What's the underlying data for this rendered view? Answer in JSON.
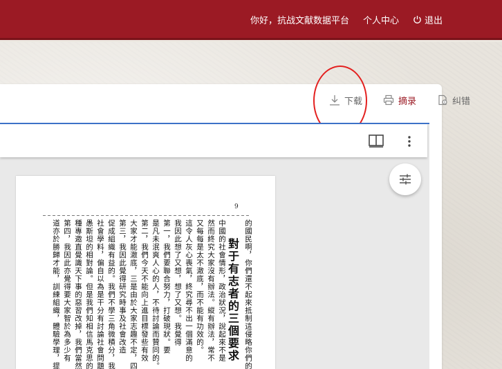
{
  "header": {
    "greeting": "你好，抗战文献数据平台",
    "personal_center": "个人中心",
    "logout": "退出"
  },
  "toolbar": {
    "download": "下载",
    "excerpt": "摘录",
    "correction": "纠错"
  },
  "document": {
    "page_number": "9",
    "columns": [
      "的國民啊，你們還不起來抵制這侵略你們的",
      "對于有志者的三個要求",
      "中國的社會情形，政治狀況，說起來不是",
      "然而終究大家沒有辦法。縱有辦法，常不",
      "又每每是太不澈底，而不能有功效的。",
      "這令人灰心喪氣，終究尋不出一個滿意的",
      "我因此想了又想，想了又想。我覺得",
      "第一，我們要聯合努力，打破現狀。要",
      "是凡未泯爽人心的人，不待討論而贊同的。",
      "第二，我們今天不能向上進目標發些有效",
      "大家才能澈底，三是由於大家志趣不定，四是",
      "第三，我因此覺得研究時事及社會改造",
      "促成組織有益的。我們不學三角微積分，我們",
      "社會學料，偏自以為是干分有討論社會問題的",
      "愚斯坦的相對論。但是我們知相信馬克思的唯",
      "種專邀直覺識天下事的惡習改掉，我們當然該",
      "第四，我因此亦覺得要大家智於為多少有",
      "道亦於勝歸才能，訓練組織，體驗學理，提高"
    ]
  },
  "icons": {
    "download": "download-icon",
    "excerpt": "printer-icon",
    "correction": "document-edit-icon",
    "logout": "power-icon",
    "viewer_mode": "book-icon",
    "more": "more-vertical-icon",
    "settings": "sliders-icon"
  },
  "colors": {
    "brand": "#9b1a24",
    "annotation_circle": "#e3201f",
    "viewer_accent": "#3c72c8"
  }
}
